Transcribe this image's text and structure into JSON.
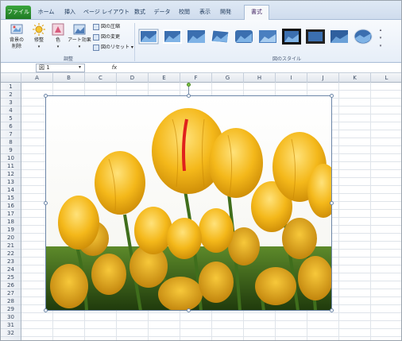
{
  "tabs": [
    "ファイル",
    "ホーム",
    "挿入",
    "ページ レイアウト",
    "数式",
    "データ",
    "校閲",
    "表示",
    "開発",
    "書式"
  ],
  "ribbon": {
    "remove_bg": "背景の\n削除",
    "corrections": "修整",
    "color": "色",
    "artistic": "アート効果",
    "compress": "図の圧縮",
    "change": "図の変更",
    "reset": "図のリセット",
    "group_adjust": "調整",
    "group_styles": "図のスタイル"
  },
  "formula_bar": {
    "name_box": "図 1",
    "fx": "fx"
  },
  "columns": [
    "A",
    "B",
    "C",
    "D",
    "E",
    "F",
    "G",
    "H",
    "I",
    "J",
    "K",
    "L"
  ],
  "rows": [
    "1",
    "2",
    "3",
    "4",
    "5",
    "6",
    "7",
    "8",
    "9",
    "10",
    "11",
    "12",
    "13",
    "14",
    "15",
    "16",
    "17",
    "18",
    "19",
    "20",
    "21",
    "22",
    "23",
    "24",
    "25",
    "26",
    "27",
    "28",
    "29",
    "30",
    "31",
    "32"
  ],
  "colors": {
    "file_tab": "#2a8c2e",
    "selection": "#6c86a8",
    "petal": "#f2b417",
    "rotate_handle": "#7ac143"
  }
}
